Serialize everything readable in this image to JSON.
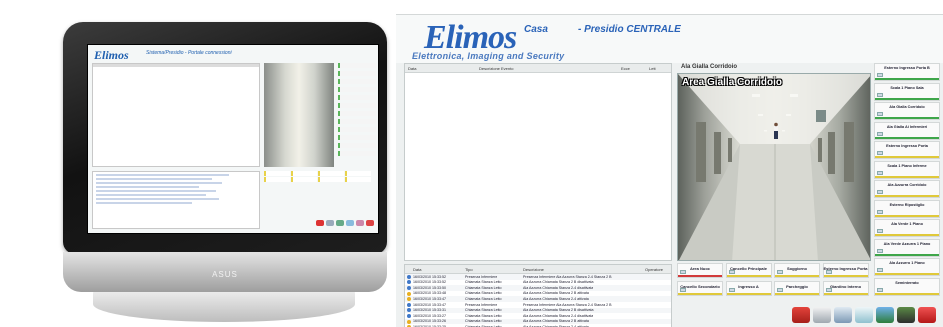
{
  "device": {
    "brand": "ASUS",
    "screen": {
      "logo": "Elimos",
      "title": "Sistema/Presidio - Portale connessioni"
    }
  },
  "app": {
    "logo": "Elimos",
    "tagline": "Elettronica, Imaging and Security",
    "location": "Casa",
    "title": "- Presidio  CENTRALE",
    "events": {
      "columns": [
        "Data",
        "Descrizione Evento",
        "Ecce",
        "Lett"
      ]
    },
    "camera": {
      "label": "Ala Gialla Corridoio",
      "overlay": "Area Gialla Corridoio"
    },
    "log": {
      "columns": [
        "Data",
        "Tipo",
        "Descrizione",
        "Operatore"
      ],
      "rows": [
        {
          "date": "16/03/2010 15:33:52",
          "type": "Presenza Infermiere",
          "desc": "Presenza Infermiere  Ala Azzurra  Stanza 2-4  Stanza 2 B",
          "icon": "info"
        },
        {
          "date": "16/03/2010 15:33:52",
          "type": "Chiamata Stanza Letto",
          "desc": "Ala Azzurra Chiamata Stanza 2 B disattivata",
          "icon": "info"
        },
        {
          "date": "16/03/2010 15:33:50",
          "type": "Chiamata Stanza Letto",
          "desc": "Ala Azzurra Chiamata Stanza 2-4 disattivata",
          "icon": "info"
        },
        {
          "date": "16/03/2010 15:33:48",
          "type": "Chiamata Stanza Letto",
          "desc": "Ala Azzurra Chiamata Stanza 2 B attivata",
          "icon": "warn"
        },
        {
          "date": "16/03/2010 15:33:47",
          "type": "Chiamata Stanza Letto",
          "desc": "Ala Azzurra Chiamata Stanza 2-4 attivata",
          "icon": "warn"
        },
        {
          "date": "16/03/2010 15:33:47",
          "type": "Presenza Infermiere",
          "desc": "Presenza Infermiere  Ala Azzurra  Stanza 2-4  Stanza 2 B",
          "icon": "info"
        },
        {
          "date": "16/03/2010 15:33:31",
          "type": "Chiamata Stanza Letto",
          "desc": "Ala Azzurra Chiamata Stanza 2 B disattivata",
          "icon": "info"
        },
        {
          "date": "16/03/2010 15:33:27",
          "type": "Chiamata Stanza Letto",
          "desc": "Ala Azzurra Chiamata Stanza 2-4 disattivata",
          "icon": "info"
        },
        {
          "date": "16/03/2010 15:33:26",
          "type": "Chiamata Stanza Letto",
          "desc": "Ala Azzurra Chiamata Stanza 2 B attivata",
          "icon": "warn"
        },
        {
          "date": "16/03/2010 15:33:25",
          "type": "Chiamata Stanza Letto",
          "desc": "Ala Azzurra Chiamata Stanza 2-4 attivata",
          "icon": "warn"
        }
      ]
    },
    "grid_buttons": [
      {
        "label": "Area Nuoc",
        "color": "#d23b3b"
      },
      {
        "label": "Cancello Principale",
        "color": "#e0c93a"
      },
      {
        "label": "Soggiorno",
        "color": "#e0c93a"
      },
      {
        "label": "Esterno Ingresso Porta",
        "color": "#e0c93a"
      },
      {
        "label": "Cancello Secondario",
        "color": "#e0c93a"
      },
      {
        "label": "Ingresso A",
        "color": "#e0c93a"
      },
      {
        "label": "Parcheggio",
        "color": "#e0c93a"
      },
      {
        "label": "Giardino Interno",
        "color": "#e0c93a"
      }
    ],
    "side_buttons": [
      {
        "label": "Esterno Ingresso Porta B",
        "color": "#3fa64a"
      },
      {
        "label": "Scala 1 Piano Sala",
        "color": "#3fa64a"
      },
      {
        "label": "Ala Gialla Corridoio",
        "color": "#3fa64a"
      },
      {
        "label": "Ala Gialla Ai Infermieri",
        "color": "#3fa64a"
      },
      {
        "label": "Esterno Ingresso Porta",
        "color": "#e0c93a"
      },
      {
        "label": "Scala 1 Piano Inferme",
        "color": "#e0c93a"
      },
      {
        "label": "Ala Azzurra Corridoio",
        "color": "#e0c93a"
      },
      {
        "label": "Esterno Ripostiglio",
        "color": "#e0c93a"
      },
      {
        "label": "Ala Verde 1 Piano",
        "color": "#e0c93a"
      },
      {
        "label": "Ala Verde Azzurra 1 Piano",
        "color": "#3fa64a"
      },
      {
        "label": "Ala Azzurro 1 Piano",
        "color": "#e0c93a"
      },
      {
        "label": "Seminterrato",
        "color": "#e0c93a"
      }
    ],
    "tray_icons": [
      "alarm-panel-icon",
      "tools-icon",
      "checklist-icon",
      "magnifier-icon",
      "images-icon",
      "brush-icon",
      "power-icon"
    ]
  }
}
